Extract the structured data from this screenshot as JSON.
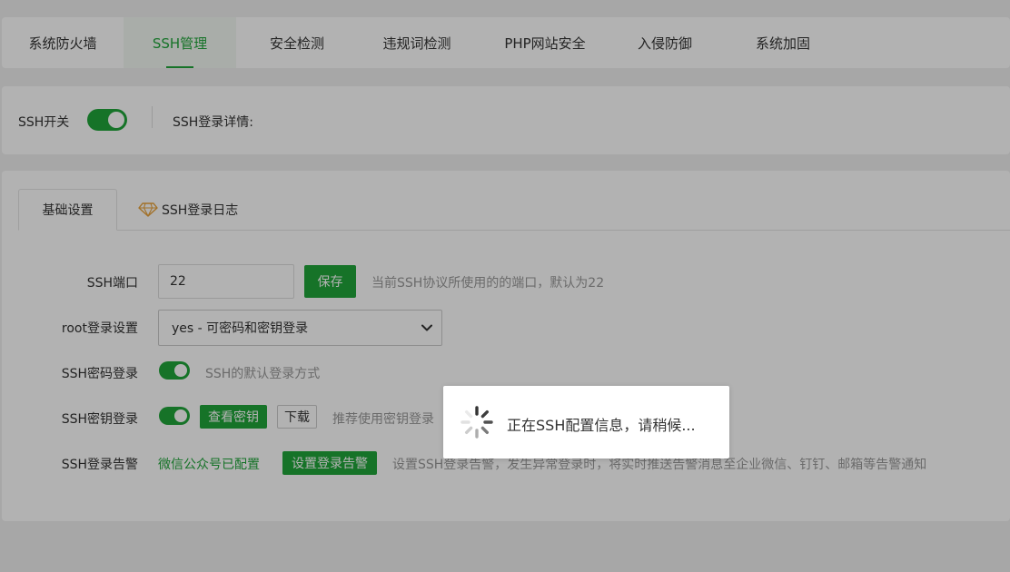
{
  "topnav": {
    "tabs": [
      {
        "label": "系统防火墙"
      },
      {
        "label": "SSH管理"
      },
      {
        "label": "安全检测"
      },
      {
        "label": "违规词检测"
      },
      {
        "label": "PHP网站安全"
      },
      {
        "label": "入侵防御"
      },
      {
        "label": "系统加固"
      }
    ],
    "active_index": 1
  },
  "status": {
    "ssh_switch_label": "SSH开关",
    "ssh_switch_on": true,
    "login_detail_label": "SSH登录详情:"
  },
  "subtabs": {
    "basic": "基础设置",
    "log": "SSH登录日志"
  },
  "form": {
    "port": {
      "label": "SSH端口",
      "value": "22",
      "save_label": "保存",
      "hint": "当前SSH协议所使用的的端口，默认为22"
    },
    "root_login": {
      "label": "root登录设置",
      "selected": "yes - 可密码和密钥登录"
    },
    "password_login": {
      "label": "SSH密码登录",
      "enabled": true,
      "hint": "SSH的默认登录方式"
    },
    "key_login": {
      "label": "SSH密钥登录",
      "enabled": true,
      "view_key_label": "查看密钥",
      "download_label": "下载",
      "hint": "推荐使用密钥登录"
    },
    "login_alert": {
      "label": "SSH登录告警",
      "status_text": "微信公众号已配置",
      "set_alert_label": "设置登录告警",
      "hint": "设置SSH登录告警，发生异常登录时，将实时推送告警消息至企业微信、钉钉、邮箱等告警通知"
    }
  },
  "loading": {
    "message": "正在SSH配置信息，请稍候..."
  },
  "colors": {
    "accent": "#20a53a",
    "background": "#f0f0f0",
    "overlay": "rgba(0,0,0,0.3)"
  }
}
